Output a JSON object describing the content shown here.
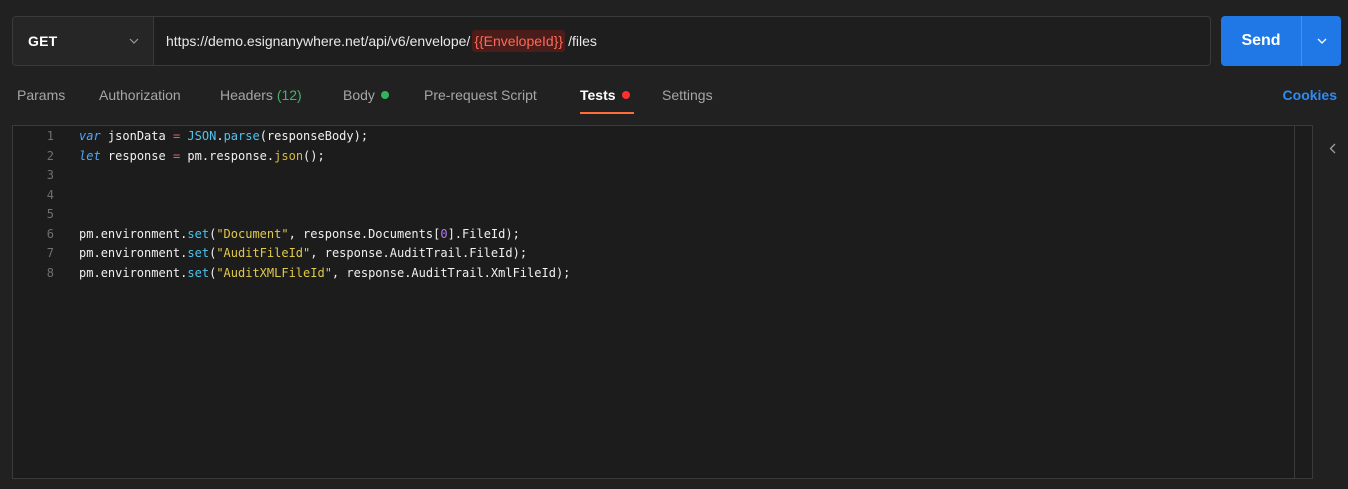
{
  "request": {
    "method": "GET",
    "url_prefix": "https://demo.esignanywhere.net/api/v6/envelope/",
    "url_variable": "{{EnvelopeId}}",
    "url_suffix": "/files"
  },
  "send": {
    "label": "Send"
  },
  "tabs": [
    {
      "label": "Params"
    },
    {
      "label": "Authorization"
    },
    {
      "label": "Headers",
      "count": "(12)"
    },
    {
      "label": "Body",
      "dot_color": "#2fb55a"
    },
    {
      "label": "Pre-request Script"
    },
    {
      "label": "Tests",
      "dot_color": "#ff2f2f",
      "active": true
    },
    {
      "label": "Settings"
    }
  ],
  "cookies_label": "Cookies",
  "editor": {
    "line_numbers": [
      "1",
      "2",
      "3",
      "4",
      "5",
      "6",
      "7",
      "8"
    ],
    "lines": [
      "var jsonData = JSON.parse(responseBody);",
      "let response = pm.response.json();",
      "",
      "",
      "",
      "pm.environment.set(\"Document\", response.Documents[0].FileId);",
      "pm.environment.set(\"AuditFileId\", response.AuditTrail.FileId);",
      "pm.environment.set(\"AuditXMLFileId\", response.AuditTrail.XmlFileId);"
    ]
  },
  "colors": {
    "accent_blue": "#1f78e6",
    "tab_active_underline": "#ff6c37",
    "cookies_link": "#2c8cf2",
    "url_variable": "#ff6a59"
  },
  "icons": {
    "method_dropdown": "chevron-down-icon",
    "send_dropdown": "chevron-down-icon",
    "side_panel": "chevron-left-icon"
  }
}
